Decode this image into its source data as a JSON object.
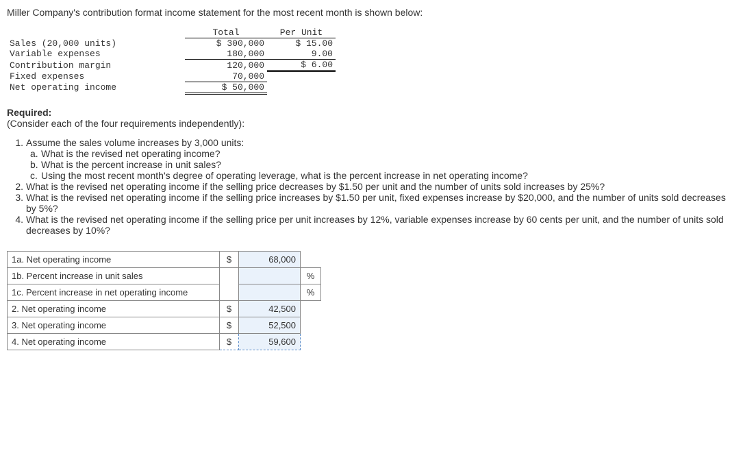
{
  "intro": "Miller Company's contribution format income statement for the most recent month is shown below:",
  "stmt": {
    "hdr_total": "Total",
    "hdr_perunit": "Per Unit",
    "rows": [
      {
        "label": "Sales (20,000 units)",
        "total": "$ 300,000",
        "perunit": "$ 15.00"
      },
      {
        "label": "Variable expenses",
        "total": "180,000",
        "perunit": "9.00"
      },
      {
        "label": "Contribution margin",
        "total": "120,000",
        "perunit": "$ 6.00"
      },
      {
        "label": "Fixed expenses",
        "total": "70,000",
        "perunit": ""
      },
      {
        "label": "Net operating income",
        "total": "$ 50,000",
        "perunit": ""
      }
    ]
  },
  "required_title": "Required:",
  "required_sub": "(Consider each of the four requirements independently):",
  "questions": {
    "q1": "Assume the sales volume increases by 3,000 units:",
    "q1a": "What is the revised net operating income?",
    "q1b": "What is the percent increase in unit sales?",
    "q1c": "Using the most recent month's degree of operating leverage, what is the percent increase in net operating income?",
    "q2": "What is the revised net operating income if the selling price decreases by $1.50 per unit and the number of units sold increases by 25%?",
    "q3": "What is the revised net operating income if the selling price increases by $1.50 per unit, fixed expenses increase by $20,000, and the number of units sold decreases by 5%?",
    "q4": "What is the revised net operating income if the selling price per unit increases by 12%, variable expenses increase by 60 cents per unit, and the number of units sold decreases by 10%?"
  },
  "answers": {
    "r1a": {
      "label": "1a. Net operating income",
      "cur": "$",
      "val": "68,000",
      "unit": ""
    },
    "r1b": {
      "label": "1b. Percent increase in unit sales",
      "cur": "",
      "val": "",
      "unit": "%"
    },
    "r1c": {
      "label": "1c. Percent increase in net operating income",
      "cur": "",
      "val": "",
      "unit": "%"
    },
    "r2": {
      "label": "2. Net operating income",
      "cur": "$",
      "val": "42,500",
      "unit": ""
    },
    "r3": {
      "label": "3. Net operating income",
      "cur": "$",
      "val": "52,500",
      "unit": ""
    },
    "r4": {
      "label": "4. Net operating income",
      "cur": "$",
      "val": "59,600",
      "unit": ""
    }
  }
}
